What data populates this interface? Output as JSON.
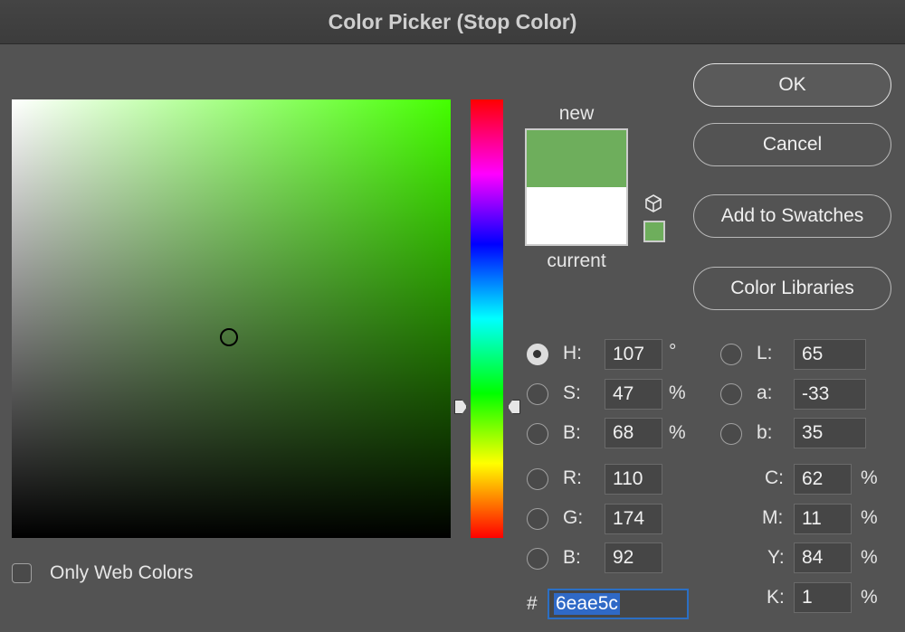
{
  "window": {
    "title": "Color Picker (Stop Color)"
  },
  "colors": {
    "new": "#6eae5c",
    "current": "#ffffff",
    "hue_pure": "#44ff00",
    "hex_selection": "#2f69c6"
  },
  "preview": {
    "new_label": "new",
    "current_label": "current"
  },
  "buttons": {
    "ok": "OK",
    "cancel": "Cancel",
    "add_to_swatches": "Add to Swatches",
    "color_libraries": "Color Libraries"
  },
  "hsb": [
    {
      "label": "H:",
      "value": "107",
      "unit": "°",
      "selected": true
    },
    {
      "label": "S:",
      "value": "47",
      "unit": "%",
      "selected": false
    },
    {
      "label": "B:",
      "value": "68",
      "unit": "%",
      "selected": false
    }
  ],
  "rgb": [
    {
      "label": "R:",
      "value": "110"
    },
    {
      "label": "G:",
      "value": "174"
    },
    {
      "label": "B:",
      "value": "92"
    }
  ],
  "lab": [
    {
      "label": "L:",
      "value": "65"
    },
    {
      "label": "a:",
      "value": "-33"
    },
    {
      "label": "b:",
      "value": "35"
    }
  ],
  "cmyk": [
    {
      "label": "C:",
      "value": "62",
      "unit": "%"
    },
    {
      "label": "M:",
      "value": "11",
      "unit": "%"
    },
    {
      "label": "Y:",
      "value": "84",
      "unit": "%"
    },
    {
      "label": "K:",
      "value": "1",
      "unit": "%"
    }
  ],
  "hex": {
    "prefix": "#",
    "value": "6eae5c"
  },
  "web_colors": {
    "label": "Only Web Colors",
    "checked": false
  },
  "icons": {
    "gamut_warning": "cube-icon",
    "web_safe_swatch": "square-swatch-icon"
  }
}
